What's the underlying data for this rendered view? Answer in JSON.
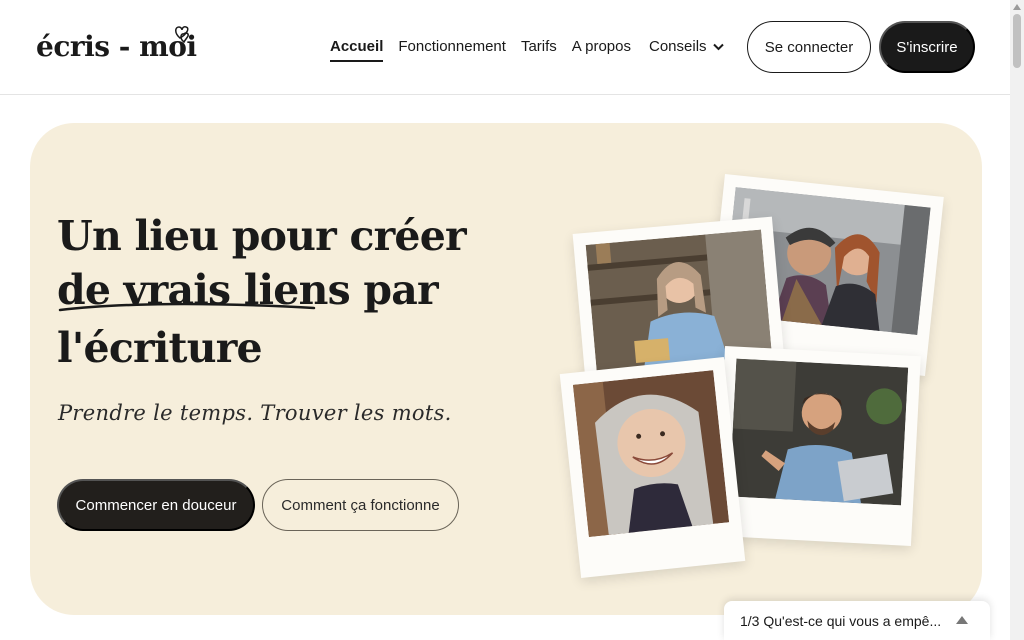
{
  "brand": {
    "logo_text": "écris - moi"
  },
  "nav": {
    "items": [
      {
        "label": "Accueil",
        "active": true
      },
      {
        "label": "Fonctionnement"
      },
      {
        "label": "Tarifs"
      },
      {
        "label": "A propos"
      }
    ],
    "dropdown": {
      "label": "Conseils",
      "icon": "chevron-down-icon"
    }
  },
  "auth": {
    "login_label": "Se connecter",
    "signup_label": "S'inscrire"
  },
  "hero": {
    "title_line1": "Un lieu pour créer",
    "title_line2": "de vrais liens par",
    "title_line3": "l'écriture",
    "tagline": "Prendre le temps. Trouver les mots.",
    "primary_cta": "Commencer en douceur",
    "secondary_cta": "Comment ça fonctionne"
  },
  "popup": {
    "text": "1/3 Qu'est-ce qui vous a empê..."
  },
  "colors": {
    "accent": "#1a1a1a",
    "hero_bg": "#f6eedb",
    "page_bg": "#ffffff"
  }
}
